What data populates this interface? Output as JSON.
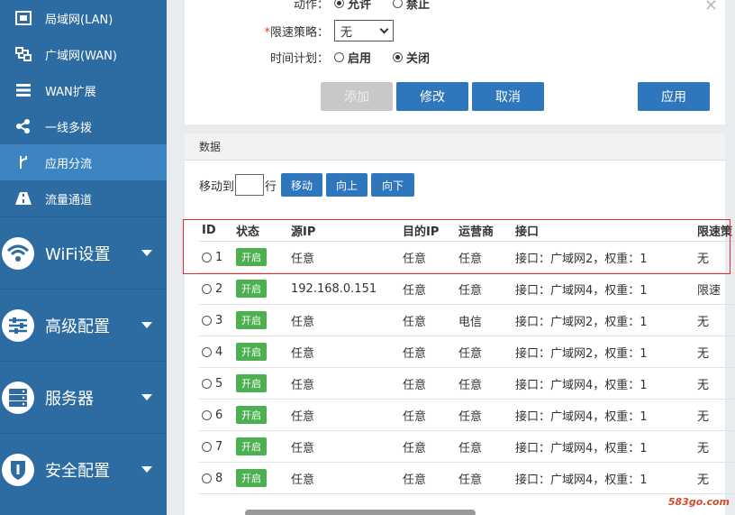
{
  "sidebar": {
    "sub_items": [
      {
        "label": "局域网(LAN)",
        "icon": "lan-icon"
      },
      {
        "label": "广域网(WAN)",
        "icon": "wan-icon"
      },
      {
        "label": "WAN扩展",
        "icon": "wan-ext-icon"
      },
      {
        "label": "一线多拨",
        "icon": "share-icon"
      },
      {
        "label": "应用分流",
        "icon": "branch-icon"
      },
      {
        "label": "流量通道",
        "icon": "road-icon"
      }
    ],
    "main_items": [
      {
        "label": "WiFi设置",
        "icon": "wifi-icon"
      },
      {
        "label": "高级配置",
        "icon": "sliders-icon"
      },
      {
        "label": "服务器",
        "icon": "server-icon"
      },
      {
        "label": "安全配置",
        "icon": "shield-icon"
      }
    ]
  },
  "form": {
    "action_label": "动作：",
    "action_options": [
      "允许",
      "禁止"
    ],
    "limit_label": "限速策略：",
    "limit_required_mark": "*",
    "limit_value": "无",
    "schedule_label": "时间计划：",
    "schedule_options": [
      "启用",
      "关闭"
    ],
    "buttons": {
      "add": "添加",
      "modify": "修改",
      "cancel": "取消",
      "apply": "应用"
    }
  },
  "data_panel": {
    "title": "数据",
    "move_to_label": "移动到",
    "row_label": "行",
    "move_button": "移动",
    "up_button": "向上",
    "down_button": "向下"
  },
  "table": {
    "headers": [
      "ID",
      "状态",
      "源IP",
      "目的IP",
      "运营商",
      "接口",
      "限速策"
    ],
    "rows": [
      {
        "id": "1",
        "status": "开启",
        "src": "任意",
        "dst": "任意",
        "isp": "任意",
        "iface": "接口：广域网2，权重：1",
        "limit": "无"
      },
      {
        "id": "2",
        "status": "开启",
        "src": "192.168.0.151",
        "dst": "任意",
        "isp": "任意",
        "iface": "接口：广域网4，权重：1",
        "limit": "限速"
      },
      {
        "id": "3",
        "status": "开启",
        "src": "任意",
        "dst": "任意",
        "isp": "电信",
        "iface": "接口：广域网2，权重：1",
        "limit": "无"
      },
      {
        "id": "4",
        "status": "开启",
        "src": "任意",
        "dst": "任意",
        "isp": "任意",
        "iface": "接口：广域网2，权重：1",
        "limit": "无"
      },
      {
        "id": "5",
        "status": "开启",
        "src": "任意",
        "dst": "任意",
        "isp": "任意",
        "iface": "接口：广域网4，权重：1",
        "limit": "无"
      },
      {
        "id": "6",
        "status": "开启",
        "src": "任意",
        "dst": "任意",
        "isp": "任意",
        "iface": "接口：广域网4，权重：1",
        "limit": "无"
      },
      {
        "id": "7",
        "status": "开启",
        "src": "任意",
        "dst": "任意",
        "isp": "任意",
        "iface": "接口：广域网4，权重：1",
        "limit": "无"
      },
      {
        "id": "8",
        "status": "开启",
        "src": "任意",
        "dst": "任意",
        "isp": "任意",
        "iface": "接口：广域网4，权重：1",
        "limit": "无"
      }
    ]
  },
  "watermark": "583go.com",
  "colors": {
    "sidebar": "#2d6ca2",
    "active": "#3d85c1",
    "button": "#2f77bd",
    "badge": "#4caf50",
    "highlight": "#e03030"
  }
}
